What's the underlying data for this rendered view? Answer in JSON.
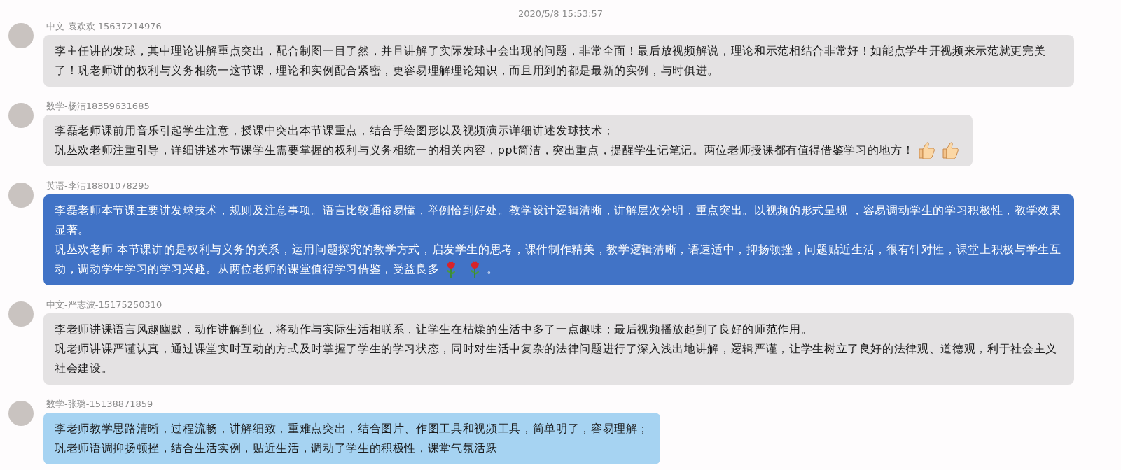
{
  "timestamp": "2020/5/8 15:53:57",
  "messages": [
    {
      "sender": "中文-袁欢欢 15637214976",
      "color": "#e4e2e3",
      "paragraphs": [
        [
          {
            "kind": "text",
            "text": "李主任讲的发球，其中理论讲解重点突出，配合制图一目了然，并且讲解了实际发球中会出现的问题，非常全面！最后放视频解说，理论和示范相结合非常好！如能点学生开视频来示范就更完美了！巩老师讲的权利与义务相统一这节课，理论和实例配合紧密，更容易理解理论知识，而且用到的都是最新的实例，与时俱进。"
          }
        ]
      ]
    },
    {
      "sender": "数学-杨洁18359631685",
      "color": "#e4e2e3",
      "paragraphs": [
        [
          {
            "kind": "text",
            "text": "李磊老师课前用音乐引起学生注意，授课中突出本节课重点，结合手绘图形以及视频演示详细讲述发球技术；"
          }
        ],
        [
          {
            "kind": "text",
            "text": "巩丛欢老师注重引导，详细讲述本节课学生需要掌握的权利与义务相统一的相关内容，ppt简洁，突出重点，提醒学生记笔记。两位老师授课都有值得借鉴学习的地方！"
          },
          {
            "kind": "thumbs_up"
          },
          {
            "kind": "thumbs_up"
          }
        ]
      ]
    },
    {
      "sender": "英语-李洁18801078295",
      "color": "#4173c6",
      "paragraphs": [
        [
          {
            "kind": "text",
            "text": "李磊老师本节课主要讲发球技术，规则及注意事项。语言比较通俗易懂，举例恰到好处。教学设计逻辑清晰，讲解层次分明，重点突出。以视频的形式呈现 ，容易调动学生的学习积极性，教学效果显著。"
          }
        ],
        [
          {
            "kind": "text",
            "text": "巩丛欢老师 本节课讲的是权利与义务的关系，运用问题探究的教学方式，启发学生的思考，课件制作精美，教学逻辑清晰，语速适中，抑扬顿挫，问题贴近生活，很有针对性，课堂上积极与学生互"
          }
        ],
        [
          {
            "kind": "text",
            "text": "动，调动学生学习的学习兴趣。从两位老师的课堂值得学习借鉴，受益良多"
          },
          {
            "kind": "rose"
          },
          {
            "kind": "rose"
          },
          {
            "kind": "text",
            "text": "。"
          }
        ]
      ]
    },
    {
      "sender": "中文-严志波-15175250310",
      "color": "#e4e2e3",
      "paragraphs": [
        [
          {
            "kind": "text",
            "text": "李老师讲课语言风趣幽默，动作讲解到位，将动作与实际生活相联系，让学生在枯燥的生活中多了一点趣味；最后视频播放起到了良好的师范作用。"
          }
        ],
        [
          {
            "kind": "text",
            "text": "巩老师讲课严谨认真，通过课堂实时互动的方式及时掌握了学生的学习状态，同时对生活中复杂的法律问题进行了深入浅出地讲解，逻辑严谨，让学生树立了良好的法律观、道德观，利于社会主义社会建设。"
          }
        ]
      ]
    },
    {
      "sender": "数学-张璐-15138871859",
      "color": "#a6d3f2",
      "paragraphs": [
        [
          {
            "kind": "text",
            "text": "李老师教学思路清晰，过程流畅，讲解细致，重难点突出，结合图片、作图工具和视频工具，简单明了，容易理解；"
          }
        ],
        [
          {
            "kind": "text",
            "text": "巩老师语调抑扬顿挫，结合生活实例，贴近生活，调动了学生的积极性，课堂气氛活跃"
          }
        ]
      ]
    }
  ]
}
